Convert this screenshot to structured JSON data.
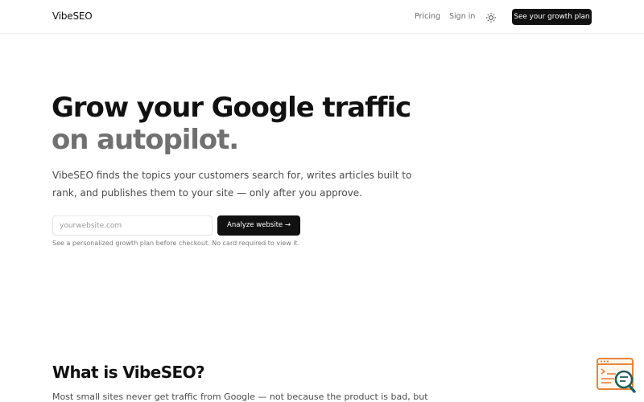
{
  "nav": {
    "logo": "VibeSEO",
    "pricing": "Pricing",
    "signin": "Sign in",
    "theme_icon": "sun-icon",
    "cta": "See your growth plan"
  },
  "hero": {
    "title_line1": "Grow your Google traffic",
    "title_line2": "on autopilot.",
    "subtitle": "VibeSEO finds the topics your customers search for, writes articles built to rank, and publishes them to your site — only after you approve.",
    "input_placeholder": "yourwebsite.com",
    "button": "Analyze website →",
    "note": "See a personalized growth plan before checkout. No card required to view it."
  },
  "about": {
    "title": "What is VibeSEO?",
    "text": "Most small sites never get traffic from Google — not because the product is bad, but"
  },
  "widget": {
    "icon": "seo-search-widget-icon",
    "accent": "#e8833a",
    "secondary": "#1f5f5b"
  },
  "colors": {
    "primary": "#111111",
    "muted_title": "#707070",
    "body_text": "#4a4a4a",
    "background": "#ffffff"
  }
}
